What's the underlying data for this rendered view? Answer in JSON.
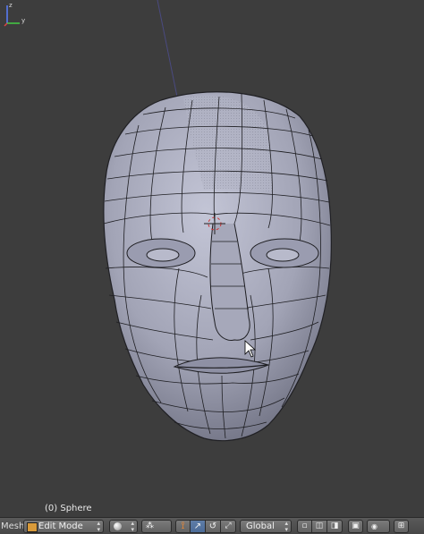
{
  "viewport": {
    "object_label": "(0) Sphere",
    "axes": {
      "z": "z",
      "y": "y"
    }
  },
  "header": {
    "editor_label": "Mesh",
    "mode": "Edit Mode",
    "orientation": "Global",
    "icons": [
      "cube-icon",
      "mode-icon",
      "shading-icon",
      "pivot-icon",
      "manipulator-icon",
      "translate-icon",
      "rotate-icon",
      "scale-icon",
      "layer-icon",
      "proportional-icon",
      "snap-icon"
    ]
  },
  "colors": {
    "background": "#3d3d3d",
    "mesh": "#a4a6b8",
    "wire": "#1e1e22",
    "header": "#505050"
  }
}
